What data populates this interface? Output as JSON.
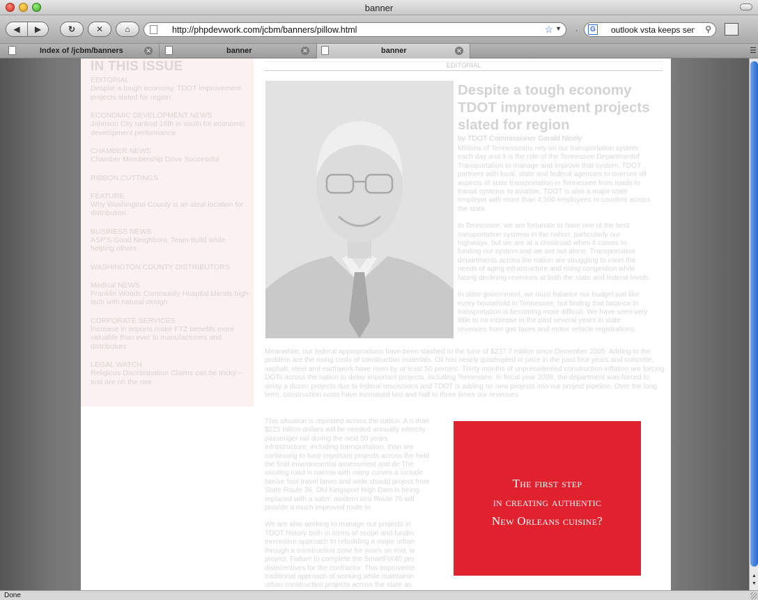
{
  "window": {
    "title": "banner"
  },
  "toolbar": {
    "url": "http://phpdevwork.com/jcbm/banners/pillow.html",
    "search_engine_letter": "G",
    "search_text": "outlook vsta keeps send"
  },
  "tabs": [
    {
      "label": "Index of /jcbm/banners",
      "active": false
    },
    {
      "label": "banner",
      "active": false
    },
    {
      "label": "banner",
      "active": true
    }
  ],
  "page": {
    "issue_heading": "IN THIS ISSUE",
    "issue_items": [
      {
        "category": "EDITORIAL",
        "desc": "Despite a tough economy, TDOT improvement projects slated for region"
      },
      {
        "category": "ECONOMIC DEVELOPMENT NEWS",
        "desc": "Johnson City ranked 16th in south for economic development performance"
      },
      {
        "category": "CHAMBER NEWS",
        "desc": "Chamber Membership Drive Successful"
      },
      {
        "category": "RIBBON CUTTINGS",
        "desc": ""
      },
      {
        "category": "FEATURE",
        "desc": "Why Washington County is an ideal location for distribution"
      },
      {
        "category": "BUSINESS NEWS",
        "desc": "ASP'S Good Neighbors: Team-build while helping others"
      },
      {
        "category": "WASHINGTON COUNTY DISTRIBUTORS",
        "desc": ""
      },
      {
        "category": "Medical NEWS",
        "desc": "Franklin Woods Community Hospital blends high-tech with natural design"
      },
      {
        "category": "CORPORATE SERVICES",
        "desc": "Increase in imports make FTZ benefits more valuable than ever to manufacturers and distributors"
      },
      {
        "category": "LEGAL WATCH",
        "desc": "Religious Discrimination Claims can be tricky -- and are on the rise"
      }
    ],
    "section_label": "EDITORIAL",
    "article_title": "Despite a tough economy TDOT improvement projects slated for region",
    "byline": "by TDOT Commissioner Gerald Nicely",
    "para1": "Millions of Tennesseans rely on our transportation system each day and it is the role of the Tennessee Departmentof Transportation to manage and improve that system. TDOT partners with local, state and federal agencies to oversee all aspects of state transportation in Tennessee from roads to transit systems to aviation. TDOT is also a major state employer with more than 4,500 employees in counties across the state.",
    "para2": "In Tennessee, we are fortunate to have one of the best transportation systems in the nation, particularly our highways, but we are at a crossroad when it comes to funding our system and we are not alone. Transportation departments across the nation are struggling to meet the needs of aging infrastructure and rising congestion while facing declining revenues at both the state and federal levels.",
    "para3": "In state government, we must balance our budget just like every household in Tennessee, but finding that balance in transportation is becoming more difficult. We have seen very little to no increase in the past several years in state revenues from gas taxes and motor vehicle registrations.",
    "para_wide": "Meanwhile, our federal appropriations have been slashed to the tune of $237.7 million since December 2005. Adding to the problem are the rising costs of construction materials. Oil has nearly quadrupled in price in the past four years and concrete, asphalt, steel and earthwork have risen by at least 50 percent. Thirty months of unprecedented construction inflation are forcing DOTs across the nation to delay important projects, including Tennessee. In fiscal year 2008, the department was forced to delay a dozen projects due to federal rescissions and TDOT is adding no new projects into our project pipeline. Over the long term, construction costs have increased two and half to three times our revenues.",
    "para_l1": "This situation is repeated across the nation. A n than $225 billion dollars will be needed annually intercity passenger rail during the next 50 years infrastructure, including transportation, than are continuing to fund important projects across the held the final environmental assessment and de The existing road is narrow with many curves a include twelve foot travel lanes and wide should project from State Route 36, Old Kingsport High Dam is being replaced with a safer, modern stru Route 75 will provide a much improved route to",
    "para_l2": "We are also working to manage our projects in TDOT history both in terms of scope and fundin innovative approach to rebuilding a major urban through a construction zone for years on end, w project. Failure to complete the SmartFIX40 pro disincentives for the contractor. This improveme traditional approach of working while maintainin urban construction projects across the state as",
    "ad_line1": "The first step",
    "ad_line2": "in creating authentic",
    "ad_line3": "New Orleans cuisine?",
    "ad_color": "#df222e"
  },
  "status": {
    "text": "Done"
  }
}
